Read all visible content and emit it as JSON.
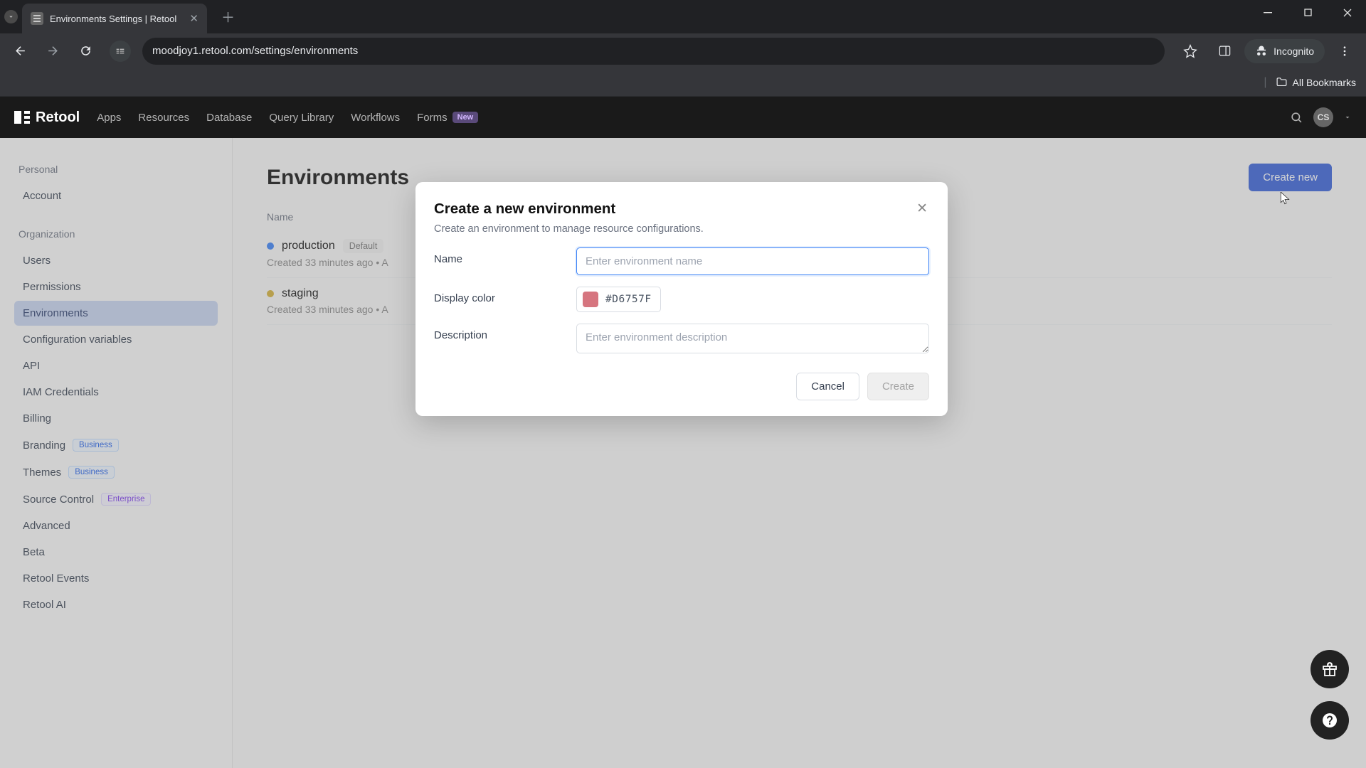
{
  "browser": {
    "tab_title": "Environments Settings | Retool",
    "url": "moodjoy1.retool.com/settings/environments",
    "incognito_label": "Incognito",
    "all_bookmarks": "All Bookmarks"
  },
  "header": {
    "brand": "Retool",
    "nav": [
      "Apps",
      "Resources",
      "Database",
      "Query Library",
      "Workflows",
      "Forms"
    ],
    "forms_badge": "New",
    "avatar_initials": "CS"
  },
  "sidebar": {
    "section_personal": "Personal",
    "section_org": "Organization",
    "personal_items": [
      "Account"
    ],
    "org_items": [
      {
        "label": "Users"
      },
      {
        "label": "Permissions"
      },
      {
        "label": "Environments",
        "active": true
      },
      {
        "label": "Configuration variables"
      },
      {
        "label": "API"
      },
      {
        "label": "IAM Credentials"
      },
      {
        "label": "Billing"
      },
      {
        "label": "Branding",
        "tag": "Business"
      },
      {
        "label": "Themes",
        "tag": "Business"
      },
      {
        "label": "Source Control",
        "tag": "Enterprise"
      },
      {
        "label": "Advanced"
      },
      {
        "label": "Beta"
      },
      {
        "label": "Retool Events"
      },
      {
        "label": "Retool AI"
      }
    ]
  },
  "main": {
    "title": "Environments",
    "create_btn": "Create new",
    "col_name": "Name",
    "rows": [
      {
        "name": "production",
        "color": "#3b82f6",
        "default": true,
        "default_label": "Default",
        "meta": "Created 33 minutes ago • A"
      },
      {
        "name": "staging",
        "color": "#d4b23a",
        "default": false,
        "meta": "Created 33 minutes ago • A"
      }
    ]
  },
  "modal": {
    "title": "Create a new environment",
    "subtitle": "Create an environment to manage resource configurations.",
    "name_label": "Name",
    "name_placeholder": "Enter environment name",
    "color_label": "Display color",
    "color_value": "#D6757F",
    "desc_label": "Description",
    "desc_placeholder": "Enter environment description",
    "cancel": "Cancel",
    "create": "Create"
  }
}
